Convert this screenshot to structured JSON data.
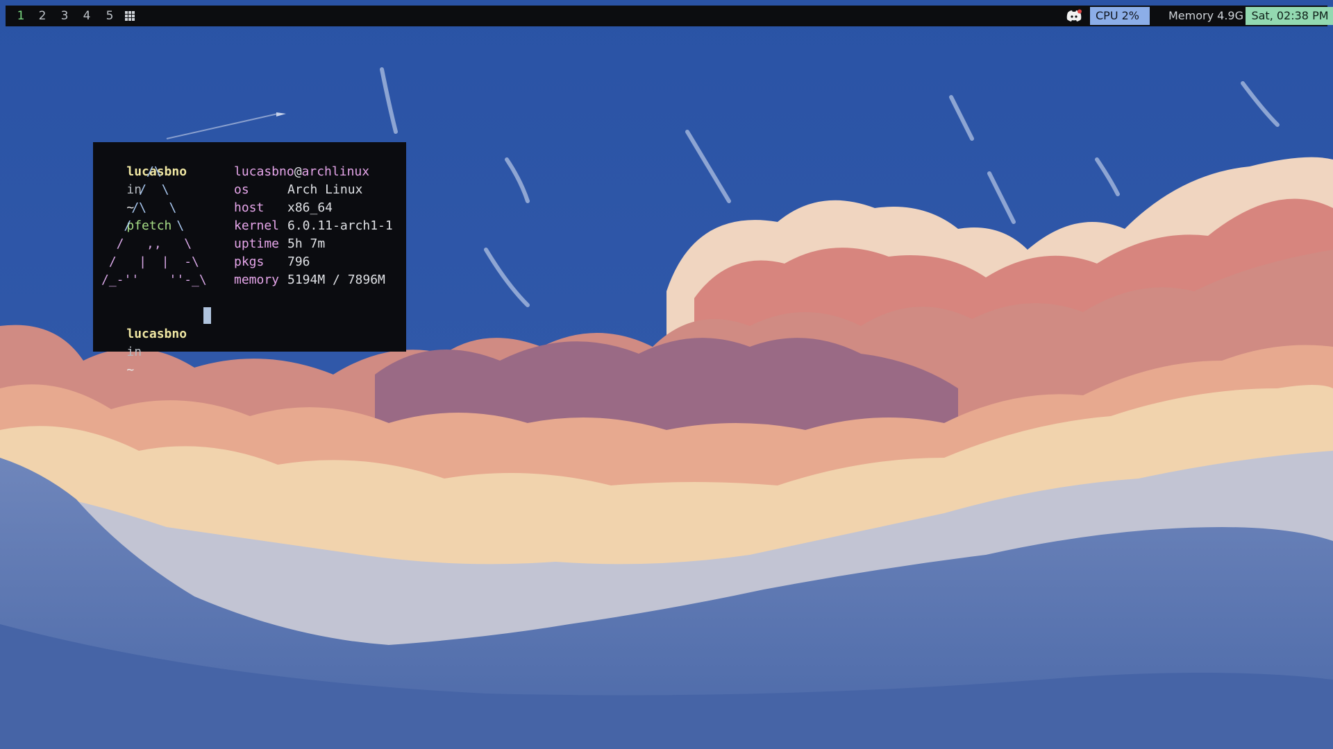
{
  "topbar": {
    "workspaces": [
      "1",
      "2",
      "3",
      "4",
      "5"
    ],
    "active_workspace": "1",
    "cpu": "CPU  2%",
    "memory": "Memory 4.9G",
    "clock": "Sat, 02:38 PM",
    "colors": {
      "cpu_bg": "#8caee8",
      "clock_bg": "#93d9b1",
      "active_ws": "#7ddc83"
    }
  },
  "terminal": {
    "prompt_user": "lucasbno",
    "prompt_in": "in",
    "prompt_dir": "~",
    "command": "pfetch",
    "logo": [
      "      /\\",
      "     /  \\",
      "    /\\   \\",
      "   /      \\",
      "  /   ,,   \\",
      " /   |  |  -\\",
      "/_-''    ''-_\\"
    ],
    "host_user": "lucasbno",
    "host_at": "@",
    "host_name": "archlinux",
    "info": [
      {
        "key": "os",
        "value": "Arch Linux"
      },
      {
        "key": "host",
        "value": "x86_64"
      },
      {
        "key": "kernel",
        "value": "6.0.11-arch1-1"
      },
      {
        "key": "uptime",
        "value": "5h 7m"
      },
      {
        "key": "pkgs",
        "value": "796"
      },
      {
        "key": "memory",
        "value": "5194M / 7896M"
      }
    ]
  }
}
